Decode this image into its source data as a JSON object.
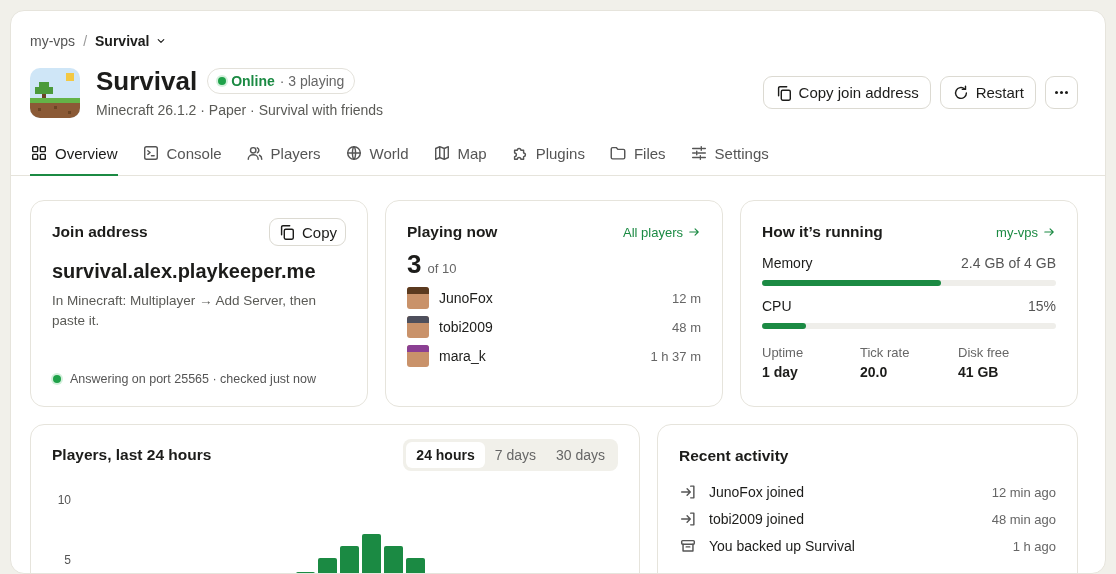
{
  "breadcrumb": {
    "parent": "my-vps",
    "separator": "/",
    "current": "Survival"
  },
  "server": {
    "name": "Survival",
    "status": "Online",
    "status_detail": "· 3 playing",
    "subtitle": "Minecraft 26.1.2 · Paper · Survival with friends"
  },
  "actions": [
    {
      "kind": "copy",
      "label": "Copy join address"
    },
    {
      "kind": "restart",
      "label": "Restart"
    },
    {
      "kind": "more"
    }
  ],
  "tabs": [
    {
      "kind": "grid",
      "label": "Overview",
      "selected": true
    },
    {
      "kind": "console",
      "label": "Console",
      "selected": false
    },
    {
      "kind": "players",
      "label": "Players",
      "selected": false
    },
    {
      "kind": "globe",
      "label": "World",
      "selected": false
    },
    {
      "kind": "map",
      "label": "Map",
      "selected": false
    },
    {
      "kind": "puzzle",
      "label": "Plugins",
      "selected": false
    },
    {
      "kind": "folder",
      "label": "Files",
      "selected": false
    },
    {
      "kind": "sliders",
      "label": "Settings",
      "selected": false
    }
  ],
  "join_card": {
    "title": "Join address",
    "copy_label": "Copy",
    "address": "survival.alex.playkeeper.me",
    "hint": "In Minecraft: Multiplayer → Add Server, then paste it.",
    "status": "Answering on port 25565 · checked just now"
  },
  "playing_card": {
    "title": "Playing now",
    "link": "All players",
    "count": "3",
    "capacity": "of 10",
    "players": [
      {
        "name": "JunoFox",
        "time": "12 m",
        "color": "#5b3a1f"
      },
      {
        "name": "tobi2009",
        "time": "48 m",
        "color": "#4e4f5c"
      },
      {
        "name": "mara_k",
        "time": "1 h 37 m",
        "color": "#8b3f93"
      }
    ]
  },
  "running_card": {
    "title": "How it’s running",
    "link": "my-vps",
    "meters": [
      {
        "label": "Memory",
        "reading": "2.4 GB of 4 GB",
        "level": 0.61
      },
      {
        "label": "CPU",
        "reading": "15%",
        "level": 0.15
      }
    ],
    "stats": [
      {
        "label": "Uptime",
        "value": "1 day"
      },
      {
        "label": "Tick rate",
        "value": "20.0"
      },
      {
        "label": "Disk free",
        "value": "41 GB"
      }
    ]
  },
  "chart_card": {
    "title": "Players, last 24 hours",
    "ranges": [
      {
        "label": "24 hours",
        "selected": true
      },
      {
        "label": "7 days",
        "selected": false
      },
      {
        "label": "30 days",
        "selected": false
      }
    ],
    "axis_labels": [
      "10",
      "5"
    ]
  },
  "activity_card": {
    "title": "Recent activity",
    "items": [
      {
        "kind": "join",
        "text": "JunoFox joined",
        "time": "12 min ago"
      },
      {
        "kind": "join",
        "text": "tobi2009 joined",
        "time": "48 min ago"
      },
      {
        "kind": "backup",
        "text": "You backed up Survival",
        "time": "1 h ago"
      }
    ]
  }
}
